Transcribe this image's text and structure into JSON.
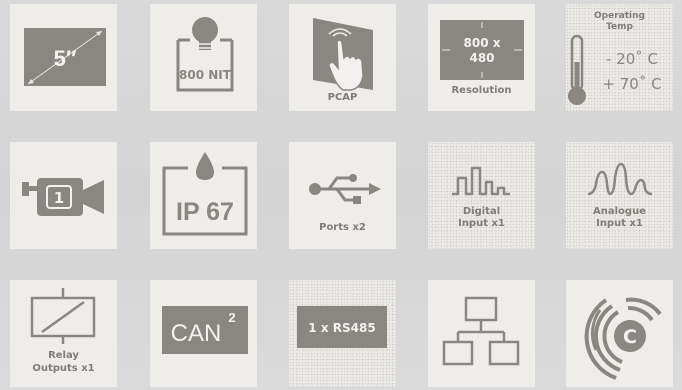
{
  "tiles": {
    "screen_size": {
      "text": "5″"
    },
    "brightness": {
      "text": "800 NIT"
    },
    "touch": {
      "label": "PCAP"
    },
    "resolution": {
      "line1": "800 x",
      "line2": "480",
      "label": "Resolution"
    },
    "operating_temp": {
      "title1": "Operating",
      "title2": "Temp",
      "low": "- 20˚ C",
      "high": "+ 70˚ C"
    },
    "camera": {
      "number": "1"
    },
    "ingress": {
      "text": "IP 67"
    },
    "usb": {
      "label": "Ports x2"
    },
    "digital": {
      "label1": "Digital",
      "label2": "Input x1"
    },
    "analogue": {
      "label1": "Analogue",
      "label2": "Input x1"
    },
    "relay": {
      "label1": "Relay",
      "label2": "Outputs x1"
    },
    "can": {
      "text": "CAN",
      "superscript": "2"
    },
    "rs485": {
      "text": "1 x RS485"
    },
    "network": {},
    "certification": {
      "letter": "C"
    }
  },
  "colors": {
    "tile": "#efedea",
    "icon": "#8a8682",
    "background": "#d8d8d8"
  }
}
